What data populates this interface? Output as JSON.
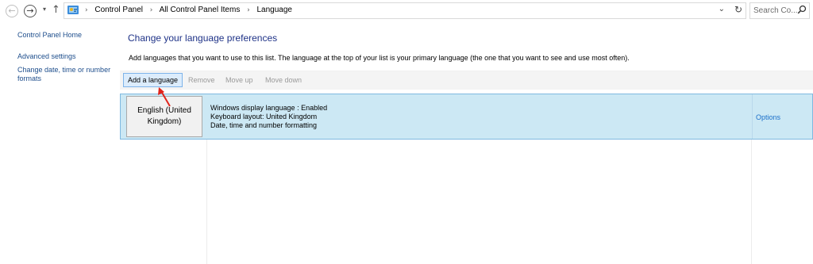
{
  "nav": {
    "back_glyph": "←",
    "forward_glyph": "→",
    "recent_glyph": "▾",
    "up_glyph": "↑",
    "breadcrumb": [
      "Control Panel",
      "All Control Panel Items",
      "Language"
    ],
    "breadcrumb_sep": "›",
    "dropdown_glyph": "⌄",
    "refresh_glyph": "↻",
    "search_placeholder": "Search Co..."
  },
  "sidebar": {
    "home": "Control Panel Home",
    "links": [
      "Advanced settings",
      "Change date, time or number formats"
    ]
  },
  "main": {
    "title": "Change your language preferences",
    "description": "Add languages that you want to use to this list. The language at the top of your list is your primary language (the one that you want to see and use most often).",
    "toolbar": {
      "add": "Add a language",
      "remove": "Remove",
      "move_up": "Move up",
      "move_down": "Move down"
    },
    "languages": [
      {
        "name": "English (United Kingdom)",
        "details": [
          "Windows display language : Enabled",
          "Keyboard layout: United Kingdom",
          "Date, time and number formatting"
        ],
        "options": "Options"
      }
    ]
  },
  "colors": {
    "link": "#1e4e8c",
    "title": "#1e3287",
    "selected_row": "#cce8f4",
    "annotation_arrow": "#e0241c"
  }
}
